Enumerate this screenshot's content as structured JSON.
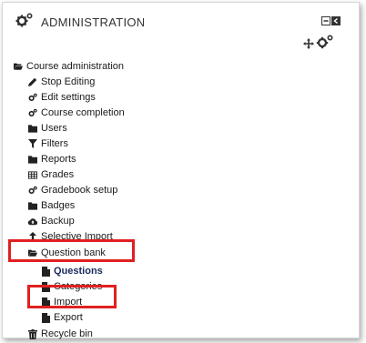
{
  "block": {
    "title": "ADMINISTRATION",
    "colors": {
      "highlight": "#e02020",
      "text": "#1a1a1a",
      "active": "#1a2a5c"
    }
  },
  "tree": [
    {
      "label": "Course administration",
      "icon": "folder-open-icon"
    },
    {
      "label": "Stop Editing",
      "icon": "pencil-icon"
    },
    {
      "label": "Edit settings",
      "icon": "gears-icon"
    },
    {
      "label": "Course completion",
      "icon": "gears-icon"
    },
    {
      "label": "Users",
      "icon": "folder-icon"
    },
    {
      "label": "Filters",
      "icon": "filter-icon"
    },
    {
      "label": "Reports",
      "icon": "folder-icon"
    },
    {
      "label": "Grades",
      "icon": "table-icon"
    },
    {
      "label": "Gradebook setup",
      "icon": "gears-icon"
    },
    {
      "label": "Badges",
      "icon": "folder-icon"
    },
    {
      "label": "Backup",
      "icon": "cloud-upload-icon"
    },
    {
      "label": "Selective Import",
      "icon": "arrow-up-icon"
    },
    {
      "label": "Question bank",
      "icon": "folder-open-icon"
    },
    {
      "label": "Questions",
      "icon": "file-icon"
    },
    {
      "label": "Categories",
      "icon": "file-icon"
    },
    {
      "label": "Import",
      "icon": "file-icon"
    },
    {
      "label": "Export",
      "icon": "file-icon"
    },
    {
      "label": "Recycle bin",
      "icon": "trash-icon"
    }
  ]
}
